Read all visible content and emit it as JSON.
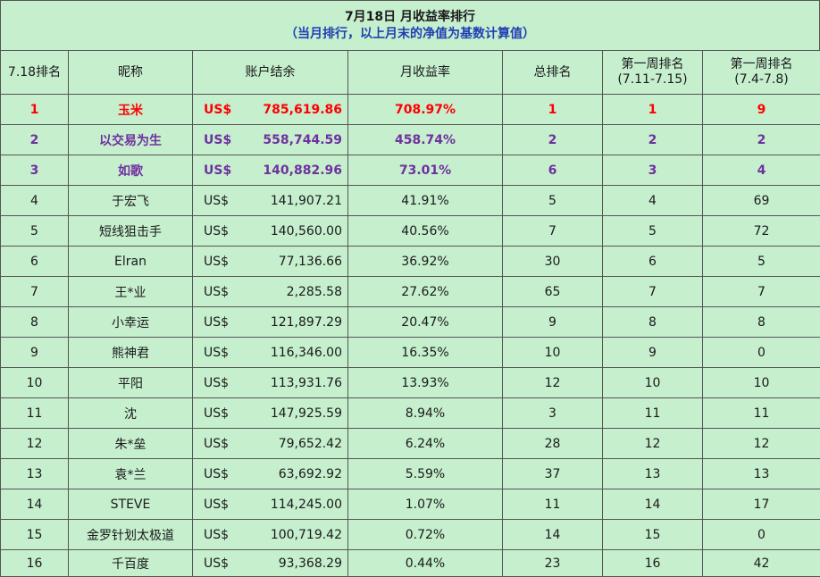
{
  "title": "7月18日 月收益率排行",
  "subtitle": "（当月排行，以上月末的净值为基数计算值）",
  "headers": {
    "rank": "7.18排名",
    "name": "昵称",
    "balance": "账户结余",
    "return": "月收益率",
    "total_rank": "总排名",
    "week1_rank": "第一周排名",
    "week1_range": "(7.11-7.15)",
    "week0_rank": "第一周排名",
    "week0_range": "(7.4-7.8)"
  },
  "currency": "US$",
  "rows": [
    {
      "rank": "1",
      "name": "玉米",
      "balance": "785,619.86",
      "return": "708.97%",
      "total_rank": "1",
      "week1": "1",
      "week0": "9"
    },
    {
      "rank": "2",
      "name": "以交易为生",
      "balance": "558,744.59",
      "return": "458.74%",
      "total_rank": "2",
      "week1": "2",
      "week0": "2"
    },
    {
      "rank": "3",
      "name": "如歌",
      "balance": "140,882.96",
      "return": "73.01%",
      "total_rank": "6",
      "week1": "3",
      "week0": "4"
    },
    {
      "rank": "4",
      "name": "于宏飞",
      "balance": "141,907.21",
      "return": "41.91%",
      "total_rank": "5",
      "week1": "4",
      "week0": "69"
    },
    {
      "rank": "5",
      "name": "短线狙击手",
      "balance": "140,560.00",
      "return": "40.56%",
      "total_rank": "7",
      "week1": "5",
      "week0": "72"
    },
    {
      "rank": "6",
      "name": "Elran",
      "balance": "77,136.66",
      "return": "36.92%",
      "total_rank": "30",
      "week1": "6",
      "week0": "5"
    },
    {
      "rank": "7",
      "name": "王*业",
      "balance": "2,285.58",
      "return": "27.62%",
      "total_rank": "65",
      "week1": "7",
      "week0": "7"
    },
    {
      "rank": "8",
      "name": "小幸运",
      "balance": "121,897.29",
      "return": "20.47%",
      "total_rank": "9",
      "week1": "8",
      "week0": "8"
    },
    {
      "rank": "9",
      "name": "熊神君",
      "balance": "116,346.00",
      "return": "16.35%",
      "total_rank": "10",
      "week1": "9",
      "week0": "0"
    },
    {
      "rank": "10",
      "name": "平阳",
      "balance": "113,931.76",
      "return": "13.93%",
      "total_rank": "12",
      "week1": "10",
      "week0": "10"
    },
    {
      "rank": "11",
      "name": "沈",
      "balance": "147,925.59",
      "return": "8.94%",
      "total_rank": "3",
      "week1": "11",
      "week0": "11"
    },
    {
      "rank": "12",
      "name": "朱*垒",
      "balance": "79,652.42",
      "return": "6.24%",
      "total_rank": "28",
      "week1": "12",
      "week0": "12"
    },
    {
      "rank": "13",
      "name": "袁*兰",
      "balance": "63,692.92",
      "return": "5.59%",
      "total_rank": "37",
      "week1": "13",
      "week0": "13"
    },
    {
      "rank": "14",
      "name": "STEVE",
      "balance": "114,245.00",
      "return": "1.07%",
      "total_rank": "11",
      "week1": "14",
      "week0": "17"
    },
    {
      "rank": "15",
      "name": "金罗针划太极道",
      "balance": "100,719.42",
      "return": "0.72%",
      "total_rank": "14",
      "week1": "15",
      "week0": "0"
    },
    {
      "rank": "16",
      "name": "千百度",
      "balance": "93,368.29",
      "return": "0.44%",
      "total_rank": "23",
      "week1": "16",
      "week0": "42"
    }
  ],
  "colors": {
    "background": "#c6efce",
    "rank1_text": "#ff0000",
    "rank2_3_text": "#7030a0",
    "subtitle_text": "#1f3fb3"
  }
}
